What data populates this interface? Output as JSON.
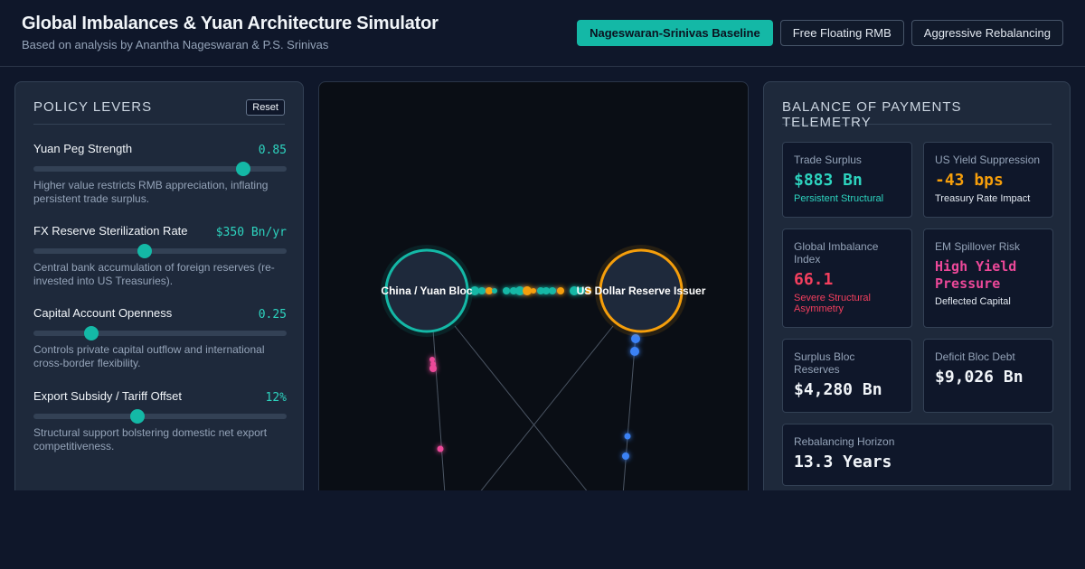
{
  "header": {
    "title": "Global Imbalances & Yuan Architecture Simulator",
    "subtitle": "Based on analysis by Anantha Nageswaran & P.S. Srinivas",
    "scenarios": [
      {
        "label": "Nageswaran-Srinivas Baseline",
        "active": true
      },
      {
        "label": "Free Floating RMB",
        "active": false
      },
      {
        "label": "Aggressive Rebalancing",
        "active": false
      }
    ]
  },
  "levers": {
    "title": "Policy Levers",
    "reset_label": "Reset",
    "items": [
      {
        "label": "Yuan Peg Strength",
        "value": "0.85",
        "level": 0.83,
        "desc": "Higher value restricts RMB appreciation, inflating persistent trade surplus."
      },
      {
        "label": "FX Reserve Sterilization Rate",
        "value": "$350 Bn/yr",
        "level": 0.44,
        "desc": "Central bank accumulation of foreign reserves (re-invested into US Treasuries)."
      },
      {
        "label": "Capital Account Openness",
        "value": "0.25",
        "level": 0.23,
        "desc": "Controls private capital outflow and international cross-border flexibility."
      },
      {
        "label": "Export Subsidy / Tariff Offset",
        "value": "12%",
        "level": 0.41,
        "desc": "Structural support bolstering domestic net export competitiveness."
      }
    ]
  },
  "diagram": {
    "node_china": "China / Yuan Bloc",
    "node_us": "US Dollar Reserve Issuer",
    "colors": {
      "china": "#14b8a6",
      "us": "#f59e0b",
      "pink": "#ec4899",
      "blue": "#3b82f6"
    }
  },
  "telemetry": {
    "title": "Balance of Payments Telemetry",
    "cards": [
      {
        "label": "Trade Surplus",
        "value": "$883 Bn",
        "sub": "Persistent Structural",
        "value_color": "#2dd4bf",
        "sub_color": "#2dd4bf"
      },
      {
        "label": "US Yield Suppression",
        "value": "-43 bps",
        "sub": "Treasury Rate Impact",
        "value_color": "#f59e0b",
        "sub_color": "#e2e8f0"
      },
      {
        "label": "Global Imbalance Index",
        "value": "66.1",
        "sub": "Severe Structural Asymmetry",
        "value_color": "#f43f5e",
        "sub_color": "#f43f5e"
      },
      {
        "label": "EM Spillover Risk",
        "value": "High Yield Pressure",
        "sub": "Deflected Capital",
        "value_color": "#ec4899",
        "sub_color": "#e2e8f0"
      },
      {
        "label": "Surplus Bloc Reserves",
        "value": "$4,280 Bn",
        "sub": "",
        "value_color": "#f1f5f9",
        "sub_color": "#e2e8f0"
      },
      {
        "label": "Deficit Bloc Debt",
        "value": "$9,026 Bn",
        "sub": "",
        "value_color": "#f1f5f9",
        "sub_color": "#e2e8f0"
      },
      {
        "label": "Rebalancing Horizon",
        "value": "13.3 Years",
        "sub": "",
        "value_color": "#f1f5f9",
        "sub_color": "#e2e8f0"
      }
    ]
  }
}
